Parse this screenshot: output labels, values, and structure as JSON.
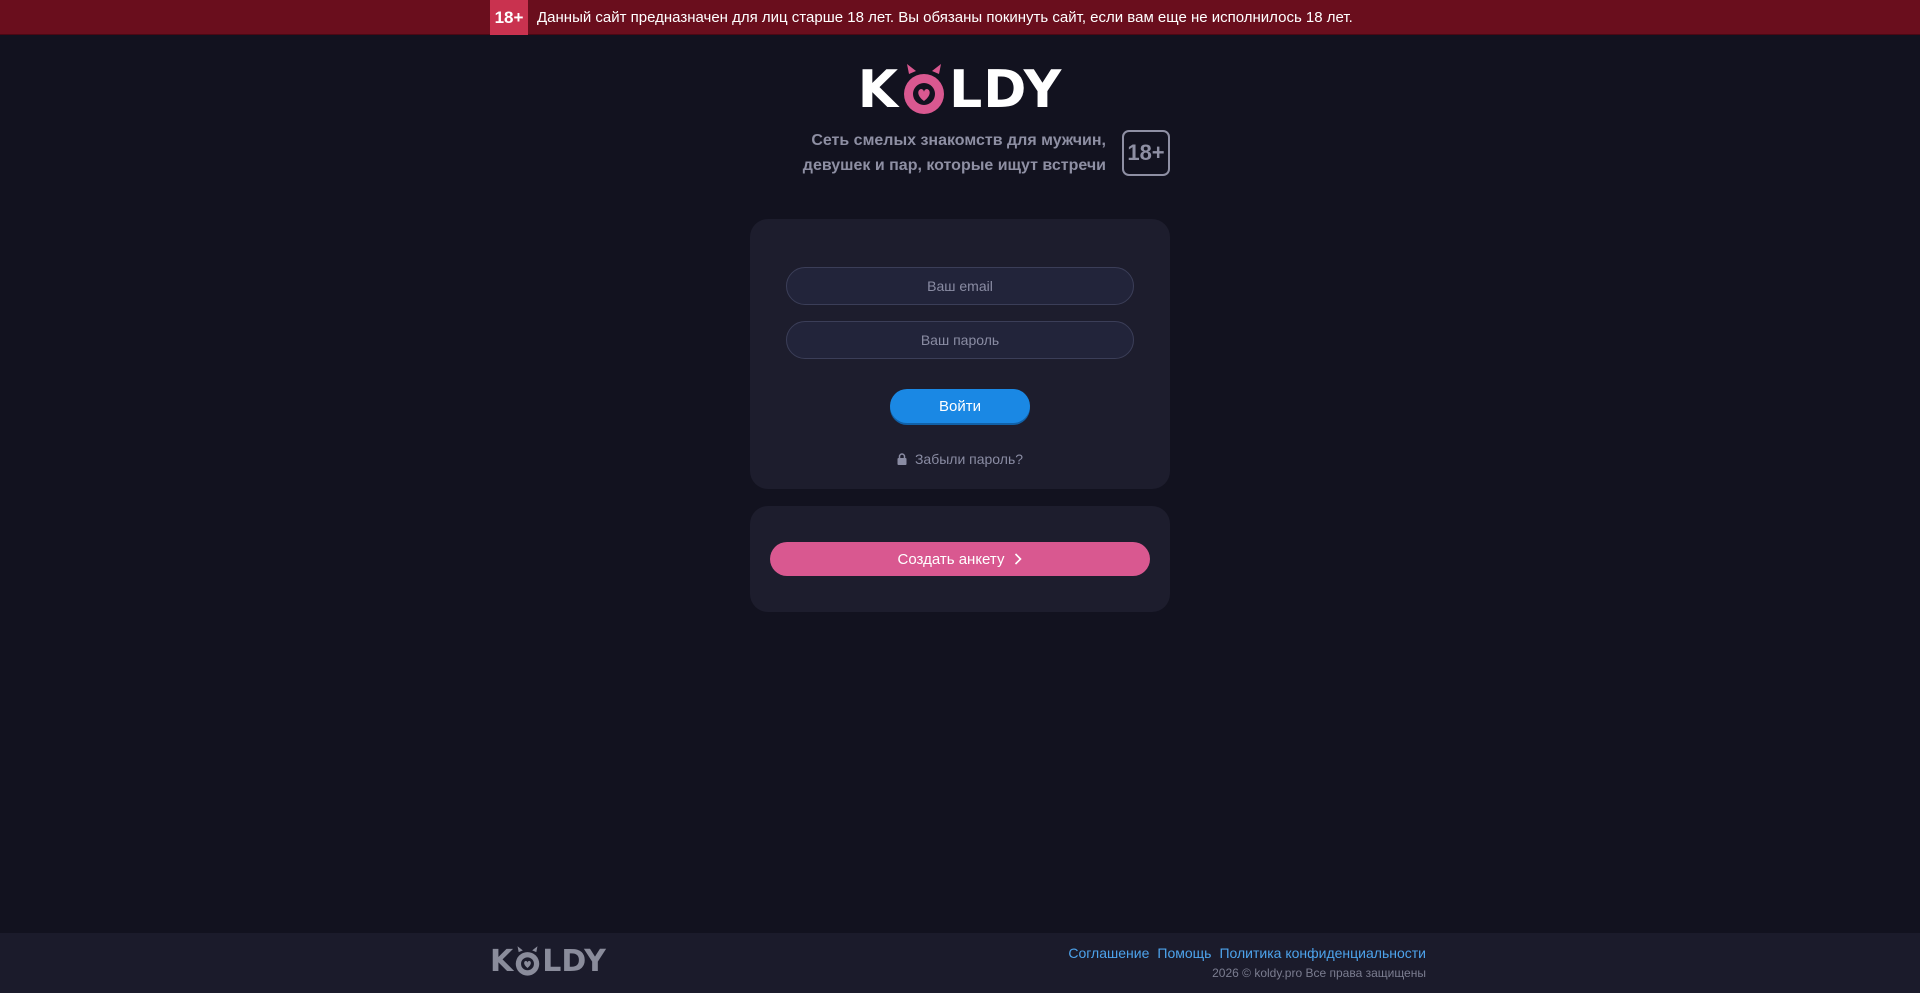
{
  "warning_bar": {
    "badge": "18+",
    "text": "Данный сайт предназначен для лиц старше 18 лет. Вы обязаны покинуть сайт, если вам еще не исполнилось 18 лет."
  },
  "logo": {
    "text_left": "K",
    "text_right": "LDY"
  },
  "tagline": {
    "line1": "Сеть смелых знакомств для мужчин,",
    "line2": "девушек и пар, которые ищут встречи",
    "age_badge": "18+"
  },
  "login_form": {
    "email_placeholder": "Ваш email",
    "password_placeholder": "Ваш пароль",
    "login_button": "Войти",
    "forgot_link": "Забыли пароль?"
  },
  "register": {
    "button": "Создать анкету"
  },
  "footer": {
    "logo_text_left": "K",
    "logo_text_right": "LDY",
    "links": [
      "Соглашение",
      "Помощь",
      "Политика конфиденциальности"
    ],
    "copyright": "2026 © koldy.pro Все права защищены"
  },
  "colors": {
    "background": "#12121f",
    "card": "#1d1d2d",
    "warning_bar": "#6a0e1d",
    "login_button": "#1a88e4",
    "register_button": "#d95890",
    "brand_pink": "#d95890",
    "link": "#4da3ec"
  },
  "icons": {
    "forgot": "lock-icon",
    "register": "chevron-right-icon",
    "logo_o": "devil-heart-icon"
  }
}
